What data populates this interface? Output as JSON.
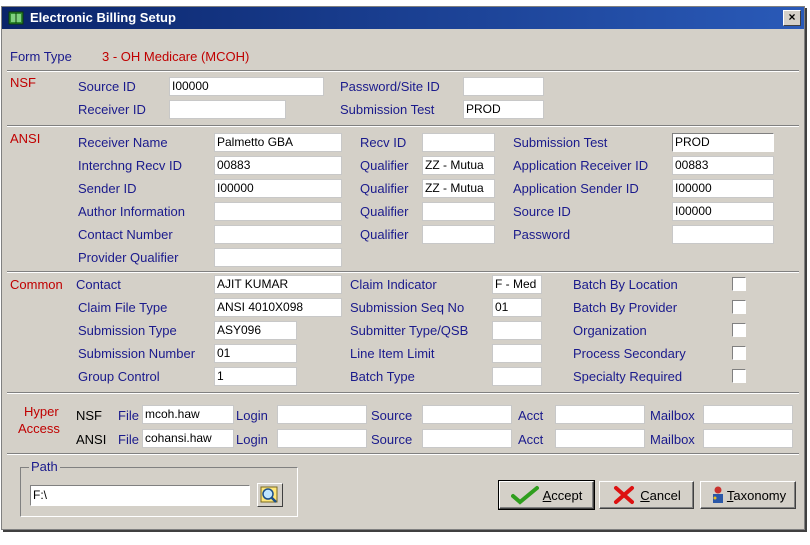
{
  "window": {
    "title": "Electronic Billing Setup",
    "close_label": "×"
  },
  "form_type": {
    "label": "Form Type",
    "value": "3 - OH Medicare (MCOH)"
  },
  "nsf": {
    "section_label": "NSF",
    "source_id_label": "Source ID",
    "source_id": "I00000",
    "receiver_id_label": "Receiver ID",
    "receiver_id": "",
    "password_label": "Password/Site ID",
    "password": "",
    "submission_test_label": "Submission Test",
    "submission_test": "PROD"
  },
  "ansi": {
    "section_label": "ANSI",
    "receiver_name_label": "Receiver Name",
    "receiver_name": "Palmetto GBA",
    "interchng_label": "Interchng Recv ID",
    "interchng": "00883",
    "sender_id_label": "Sender ID",
    "sender_id": "I00000",
    "author_label": "Author Information",
    "author": "",
    "contact_number_label": "Contact Number",
    "contact_number": "",
    "provider_qualifier_label": "Provider Qualifier",
    "provider_qualifier": "",
    "recv_id_label": "Recv ID",
    "recv_id": "",
    "qualifier_label": "Qualifier",
    "qualifiers": [
      "ZZ - Mutua",
      "ZZ - Mutua",
      "",
      ""
    ],
    "submission_test_label": "Submission Test",
    "submission_test": "PROD",
    "app_receiver_label": "Application Receiver ID",
    "app_receiver": "00883",
    "app_sender_label": "Application Sender ID",
    "app_sender": "I00000",
    "source_id_label": "Source ID",
    "source_id": "I00000",
    "password_label": "Password",
    "password": ""
  },
  "common": {
    "section_label": "Common",
    "contact_label": "Contact",
    "contact": "AJIT KUMAR",
    "claim_file_type_label": "Claim File Type",
    "claim_file_type": "ANSI 4010X098",
    "submission_type_label": "Submission Type",
    "submission_type": "ASY096",
    "submission_number_label": "Submission Number",
    "submission_number": "01",
    "group_control_label": "Group Control",
    "group_control": "1",
    "claim_indicator_label": "Claim Indicator",
    "claim_indicator": "F - Med",
    "submission_seq_label": "Submission Seq No",
    "submission_seq": "01",
    "submitter_type_label": "Submitter Type/QSB",
    "submitter_type": "",
    "line_item_label": "Line Item Limit",
    "line_item": "",
    "batch_type_label": "Batch Type",
    "batch_type": "",
    "batch_location_label": "Batch By Location",
    "batch_provider_label": "Batch By Provider",
    "organization_label": "Organization",
    "process_secondary_label": "Process Secondary",
    "specialty_required_label": "Specialty Required"
  },
  "hyper": {
    "label_1": "Hyper",
    "label_2": "Access",
    "file_label": "File",
    "login_label": "Login",
    "source_label": "Source",
    "acct_label": "Acct",
    "mailbox_label": "Mailbox",
    "rows": [
      {
        "type": "NSF",
        "file": "mcoh.haw"
      },
      {
        "type": "ANSI",
        "file": "cohansi.haw"
      }
    ]
  },
  "path": {
    "label": "Path",
    "value": "F:\\"
  },
  "buttons": {
    "accept_u": "A",
    "accept_rest": "ccept",
    "cancel_u": "C",
    "cancel_rest": "ancel",
    "taxonomy_u": "T",
    "taxonomy_rest": "axonomy"
  },
  "colors": {
    "title_bar": "#0a246a",
    "label": "#1a1a8c",
    "section": "#c00000",
    "face": "#d4d0c8"
  }
}
